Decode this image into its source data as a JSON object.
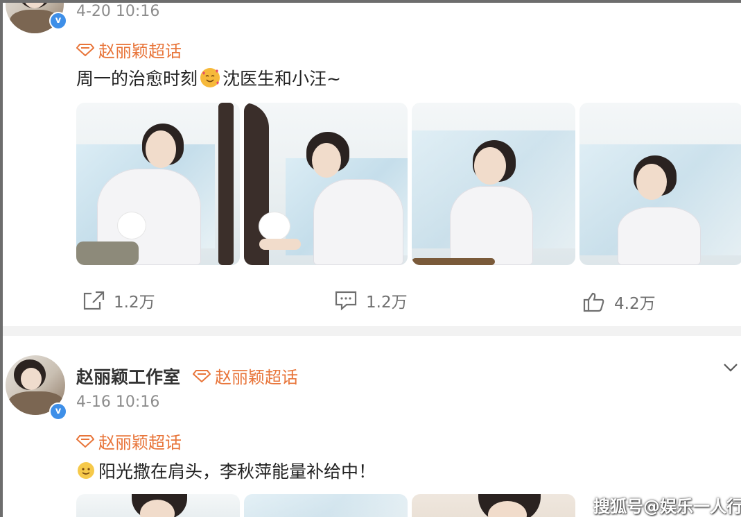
{
  "posts": [
    {
      "time": "4-20 10:16",
      "topic": "赵丽颖超话",
      "text_before": "周一的治愈时刻",
      "emoji": "smiling-face-with-hearts-emoji",
      "text_after": "沈医生和小汪~",
      "actions": {
        "share": "1.2万",
        "comment": "1.2万",
        "like": "4.2万"
      }
    },
    {
      "username": "赵丽颖工作室",
      "user_topic": "赵丽颖超话",
      "time": "4-16 10:16",
      "topic": "赵丽颖超话",
      "emoji": "smiling-face-emoji",
      "text": "阳光撒在肩头，李秋萍能量补给中！"
    }
  ],
  "watermark": "搜狐号@娱乐一人行",
  "colors": {
    "topic": "#e8753a",
    "verified": "#3e8fe8",
    "meta": "#8c8c8c",
    "divider": "#f2f2f2"
  }
}
